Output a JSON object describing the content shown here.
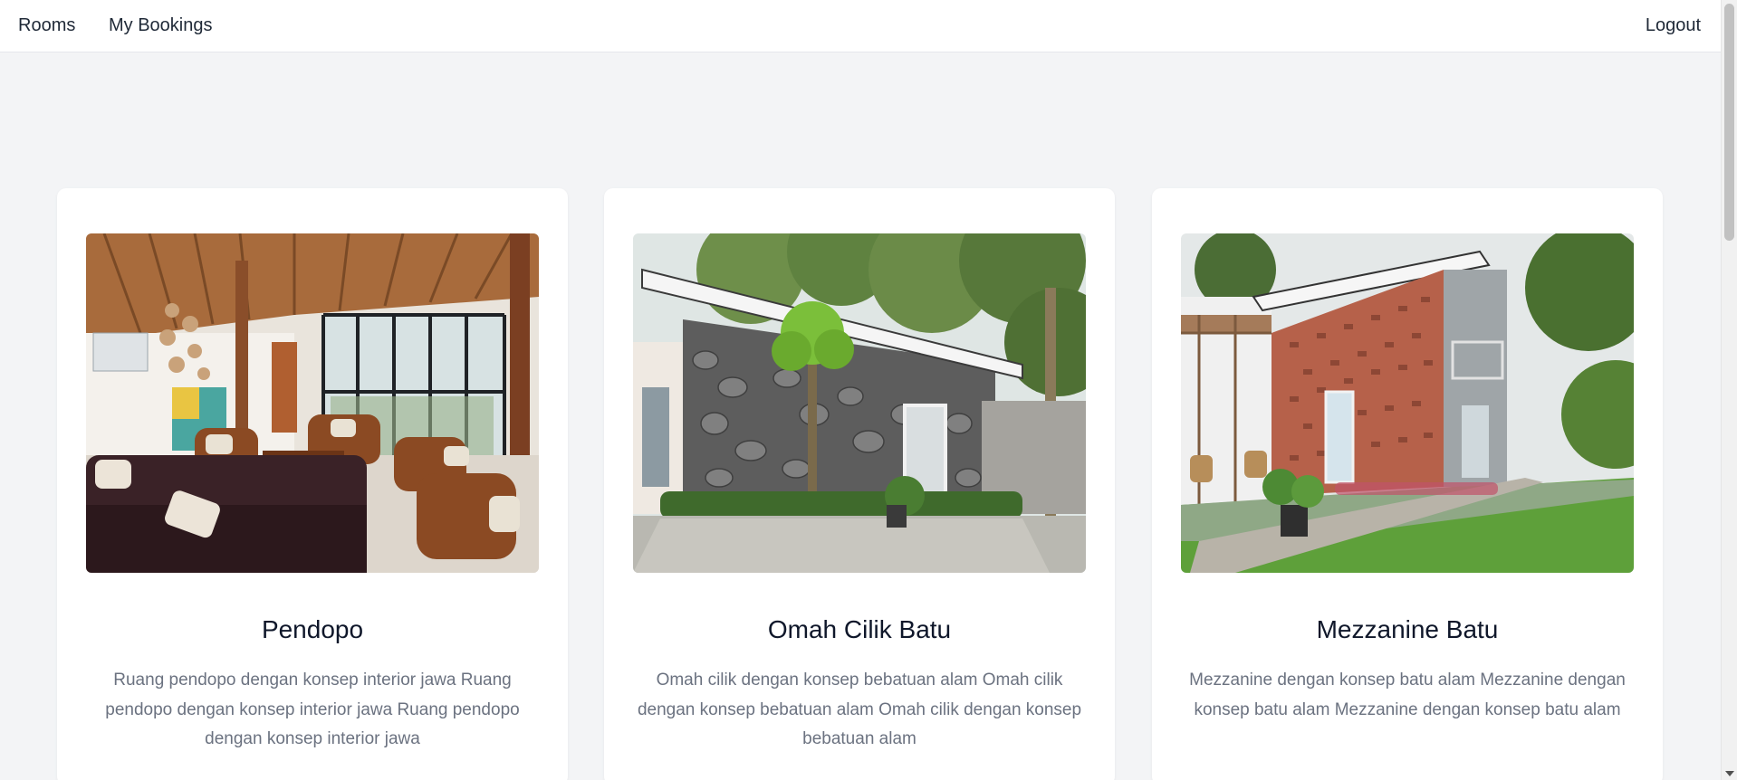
{
  "nav": {
    "rooms_label": "Rooms",
    "bookings_label": "My Bookings",
    "logout_label": "Logout"
  },
  "rooms": [
    {
      "name": "Pendopo",
      "description": "Ruang pendopo dengan konsep interior jawa Ruang pendopo dengan konsep interior jawa Ruang pendopo dengan konsep interior jawa"
    },
    {
      "name": "Omah Cilik Batu",
      "description": "Omah cilik dengan konsep bebatuan alam Omah cilik dengan konsep bebatuan alam Omah cilik dengan konsep bebatuan alam"
    },
    {
      "name": "Mezzanine Batu",
      "description": "Mezzanine dengan konsep batu alam Mezzanine dengan konsep batu alam Mezzanine dengan konsep batu alam"
    }
  ],
  "colors": {
    "background": "#f3f4f6",
    "card": "#ffffff",
    "title": "#0f172a",
    "description": "#6b7280"
  }
}
